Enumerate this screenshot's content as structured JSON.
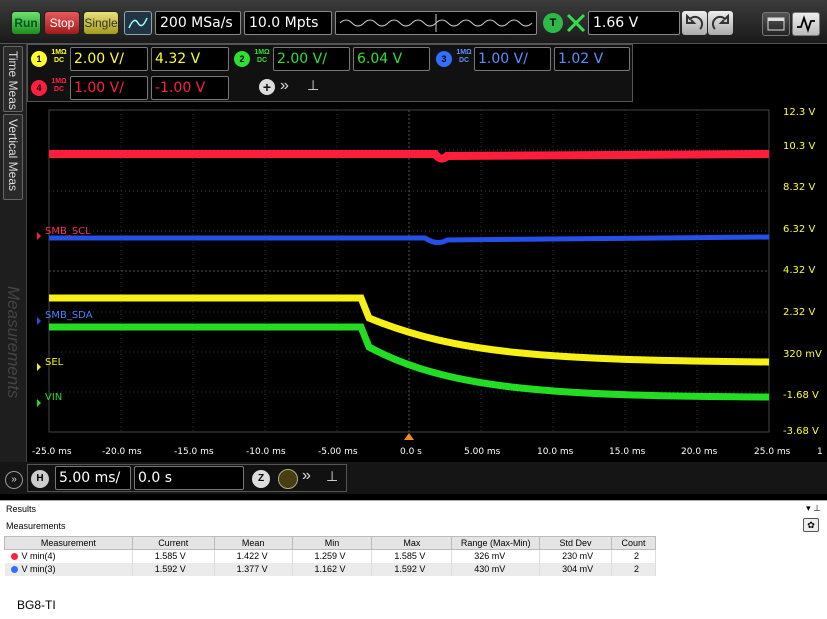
{
  "toolbar": {
    "run_label": "Run",
    "stop_label": "Stop",
    "single_label": "Single",
    "sample_rate": "200 MSa/s",
    "memory_depth": "10.0 Mpts",
    "trigger_badge": "T",
    "trigger_level": "1.66 V",
    "icons": [
      "waveform-icon",
      "trigger-edge-icon",
      "undo-icon",
      "redo-icon",
      "window-icon",
      "autoscale-icon"
    ]
  },
  "side_tabs": {
    "time_meas": "Time Meas",
    "vertical_meas": "Vertical Meas",
    "measurements": "Measurements"
  },
  "channels": [
    {
      "number": "1",
      "coupling_top": "1MΩ",
      "coupling_bottom": "DC",
      "scale": "2.00 V/",
      "offset": "4.32 V",
      "color": "#ffff30"
    },
    {
      "number": "2",
      "coupling_top": "1MΩ",
      "coupling_bottom": "DC",
      "scale": "2.00 V/",
      "offset": "6.04 V",
      "color": "#30e030"
    },
    {
      "number": "3",
      "coupling_top": "1MΩ",
      "coupling_bottom": "DC",
      "scale": "1.00 V/",
      "offset": "1.02 V",
      "color": "#3070ff"
    },
    {
      "number": "4",
      "coupling_top": "1MΩ",
      "coupling_bottom": "DC",
      "scale": "1.00 V/",
      "offset": "-1.00 V",
      "color": "#ff2040"
    }
  ],
  "screen": {
    "y_labels": [
      "12.3 V",
      "10.3 V",
      "8.32 V",
      "6.32 V",
      "4.32 V",
      "2.32 V",
      "320 mV",
      "-1.68 V",
      "-3.68 V"
    ],
    "x_labels": [
      "-25.0 ms",
      "-20.0 ms",
      "-15.0 ms",
      "-10.0 ms",
      "-5.00 ms",
      "0.0 s",
      "5.00 ms",
      "10.0 ms",
      "15.0 ms",
      "20.0 ms",
      "25.0 ms"
    ],
    "x_edge_label": "1",
    "waveform_labels": {
      "scl": "SMB_SCL",
      "sda": "SMB_SDA",
      "sel": "SEL",
      "vin": "VIN"
    }
  },
  "horizontal": {
    "badge": "H",
    "timebase": "5.00 ms/",
    "delay": "0.0 s",
    "zoom_badge": "Z"
  },
  "results": {
    "title": "Results",
    "measurements_title": "Measurements",
    "columns": [
      "Measurement",
      "Current",
      "Mean",
      "Min",
      "Max",
      "Range (Max-Min)",
      "Std Dev",
      "Count"
    ],
    "rows": [
      {
        "name": "V min(4)",
        "color": "#ff2040",
        "current": "1.585 V",
        "mean": "1.422 V",
        "min": "1.259 V",
        "max": "1.585 V",
        "range": "326 mV",
        "std": "230 mV",
        "count": "2"
      },
      {
        "name": "V min(3)",
        "color": "#3070ff",
        "current": "1.592 V",
        "mean": "1.377 V",
        "min": "1.162 V",
        "max": "1.592 V",
        "range": "430 mV",
        "std": "304 mV",
        "count": "2"
      }
    ]
  },
  "footer": "BG8-TI"
}
